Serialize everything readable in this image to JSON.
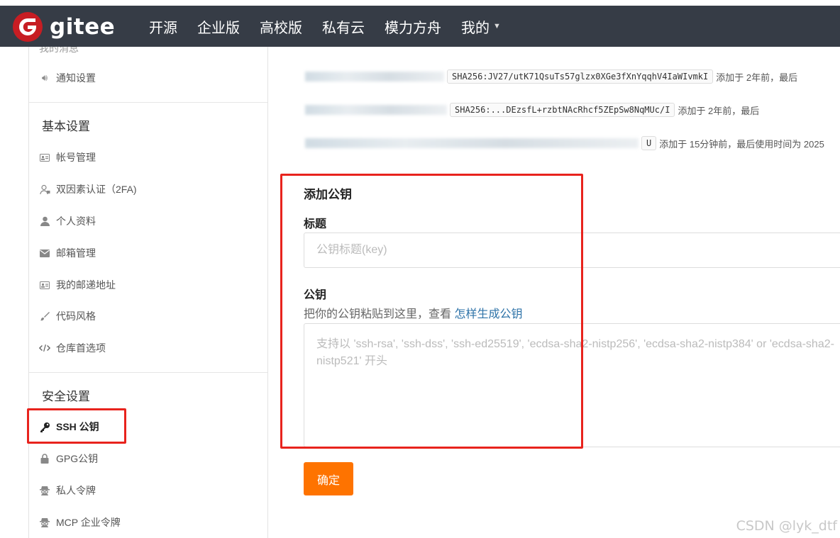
{
  "brand": {
    "name": "gitee",
    "logo_color": "#c71d23"
  },
  "nav": {
    "items": [
      {
        "label": "开源"
      },
      {
        "label": "企业版"
      },
      {
        "label": "高校版"
      },
      {
        "label": "私有云"
      },
      {
        "label": "模力方舟"
      },
      {
        "label": "我的"
      }
    ],
    "bg_color": "#363c46"
  },
  "sidebar": {
    "clipped_item": "我的消息",
    "notify_item": "通知设置",
    "basic_heading": "基本设置",
    "basic_items": [
      {
        "label": "帐号管理",
        "icon": "id-card-icon"
      },
      {
        "label": "双因素认证（2FA)",
        "icon": "user-lock-icon"
      },
      {
        "label": "个人资料",
        "icon": "user-icon"
      },
      {
        "label": "邮箱管理",
        "icon": "envelope-icon"
      },
      {
        "label": "我的邮递地址",
        "icon": "address-card-icon"
      },
      {
        "label": "代码风格",
        "icon": "brush-icon"
      },
      {
        "label": "仓库首选项",
        "icon": "code-icon"
      }
    ],
    "security_heading": "安全设置",
    "security_items": [
      {
        "label": "SSH 公钥",
        "icon": "key-icon",
        "active": true
      },
      {
        "label": "GPG公钥",
        "icon": "lock-icon"
      },
      {
        "label": "私人令牌",
        "icon": "spy-icon"
      },
      {
        "label": "MCP 企业令牌",
        "icon": "spy-icon"
      }
    ]
  },
  "keys": {
    "rows": [
      {
        "fingerprint": "SHA256:JV27/utK71QsuTs57glzx0XGe3fXnYqqhV4IaWIvmkI",
        "added": "添加于 2年前，最后"
      },
      {
        "fingerprint": "SHA256:...DEzsfL+rzbtNAcRhcf5ZEpSw8NqMUc/I",
        "added": "添加于 2年前，最后"
      },
      {
        "fingerprint": "U",
        "added": "添加于 15分钟前，最后使用时间为 2025"
      }
    ]
  },
  "form": {
    "section_title": "添加公钥",
    "title_label": "标题",
    "title_placeholder": "公钥标题(key)",
    "key_label": "公钥",
    "key_hint": "把你的公钥粘贴到这里，查看",
    "key_hint_link": "怎样生成公钥",
    "key_placeholder": "支持以 'ssh-rsa', 'ssh-dss', 'ssh-ed25519', 'ecdsa-sha2-nistp256', 'ecdsa-sha2-nistp384' or 'ecdsa-sha2-nistp521' 开头",
    "submit_label": "确定",
    "submit_color": "#fe7300",
    "link_color": "#2e73a8"
  },
  "annotation_color": "#e8231d",
  "watermark": "CSDN @lyk_dtf"
}
